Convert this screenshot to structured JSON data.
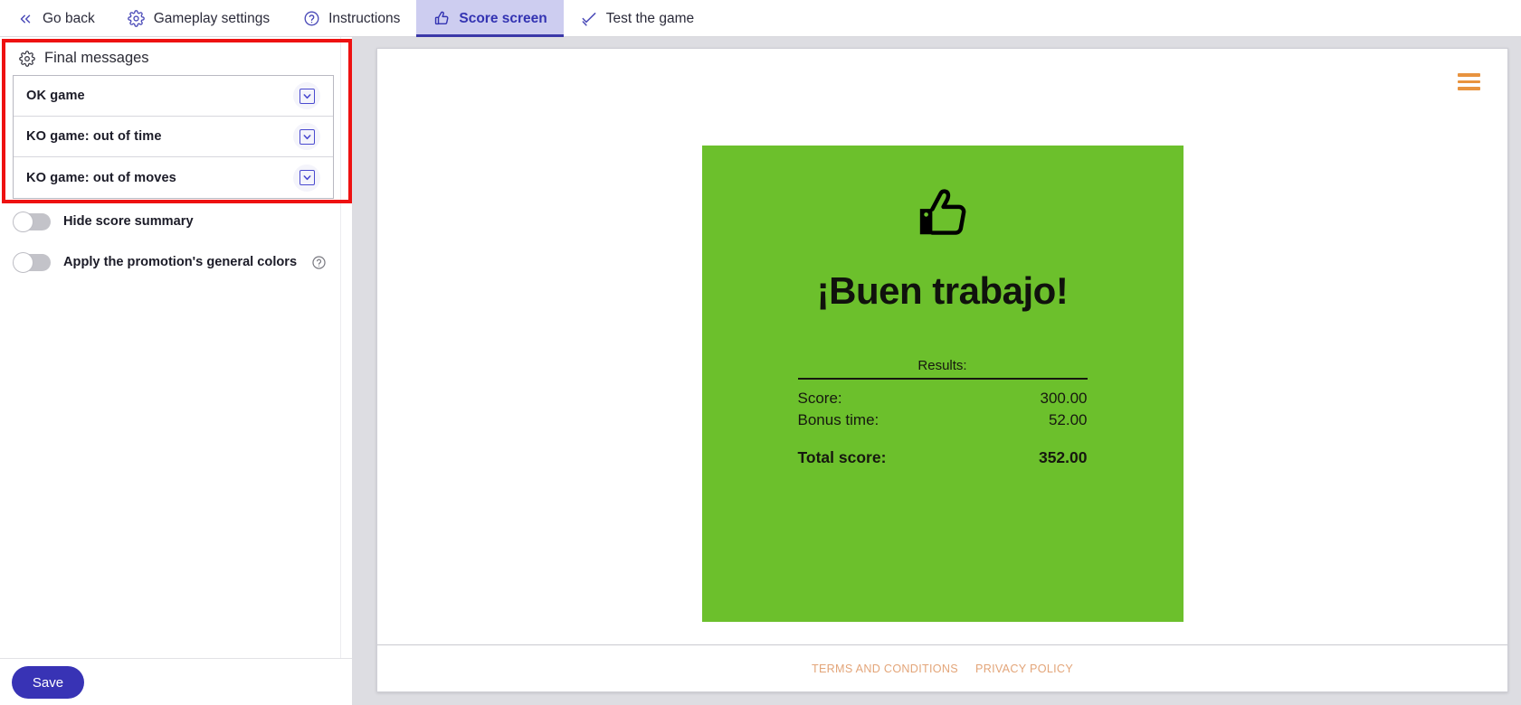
{
  "tabs": [
    {
      "label": "Go back",
      "icon": "chevrons-left-icon",
      "active": false
    },
    {
      "label": "Gameplay settings",
      "icon": "gear-icon",
      "active": false
    },
    {
      "label": "Instructions",
      "icon": "question-circle-icon",
      "active": false
    },
    {
      "label": "Score screen",
      "icon": "thumbs-up-icon",
      "active": true
    },
    {
      "label": "Test the game",
      "icon": "check-badge-icon",
      "active": false
    }
  ],
  "sidebar": {
    "panel_title": "Final messages",
    "panel_icon": "gear-icon",
    "accordion_items": [
      {
        "label": "OK game"
      },
      {
        "label": "KO game: out of time"
      },
      {
        "label": "KO game: out of moves"
      }
    ],
    "toggles": [
      {
        "label": "Hide score summary",
        "on": false,
        "has_help": false
      },
      {
        "label": "Apply the promotion's general colors",
        "on": false,
        "has_help": true
      }
    ],
    "save_label": "Save"
  },
  "preview": {
    "menu_icon": "hamburger-icon",
    "card": {
      "icon": "thumbs-up-icon",
      "title": "¡Buen trabajo!",
      "results_label": "Results:",
      "rows": [
        {
          "label": "Score:",
          "value": "300.00",
          "bold": false
        },
        {
          "label": "Bonus time:",
          "value": "52.00",
          "bold": false
        },
        {
          "label": "Total score:",
          "value": "352.00",
          "bold": true
        }
      ]
    },
    "footer_links": [
      {
        "label": "TERMS AND CONDITIONS"
      },
      {
        "label": "PRIVACY POLICY"
      }
    ]
  },
  "colors": {
    "card_green": "#6cc02c",
    "accent_blue": "#3833b5",
    "active_tab_bg": "#cdcdf0",
    "footer_link": "#e3a579",
    "hamburger_orange": "#e8933f",
    "annotation_red": "#ee1111"
  }
}
